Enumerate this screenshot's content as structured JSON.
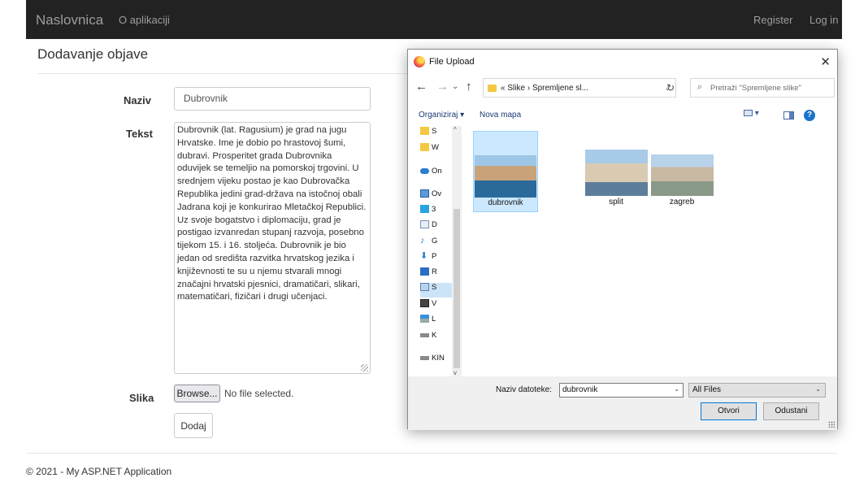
{
  "navbar": {
    "brand": "Naslovnica",
    "about": "O aplikaciji",
    "register": "Register",
    "login": "Log in"
  },
  "page": {
    "heading": "Dodavanje objave"
  },
  "form": {
    "naziv_label": "Naziv",
    "naziv_value": "Dubrovnik",
    "tekst_label": "Tekst",
    "tekst_value": "Dubrovnik (lat. Ragusium) je grad na jugu Hrvatske. Ime je dobio po hrastovoj šumi, dubravi. Prosperitet grada Dubrovnika oduvijek se temeljio na pomorskoj trgovini. U srednjem vijeku postao je kao Dubrovačka Republika jedini grad-država na istočnoj obali Jadrana koji je konkurirao Mletačkoj Republici. Uz svoje bogatstvo i diplomaciju, grad je postigao izvanredan stupanj razvoja, posebno tijekom 15. i 16. stoljeća. Dubrovnik je bio jedan od središta razvitka hrvatskog jezika i književnosti te su u njemu stvarali mnogi značajni hrvatski pjesnici, dramatičari, slikari, matematičari, fizičari i drugi učenjaci.",
    "slika_label": "Slika",
    "browse_label": "Browse...",
    "file_status": "No file selected.",
    "submit_label": "Dodaj"
  },
  "footer": {
    "text": "© 2021 - My ASP.NET Application"
  },
  "dialog": {
    "title": "File Upload",
    "close": "✕",
    "address": {
      "prefix": "«",
      "crumb1": "Slike",
      "sep": "›",
      "crumb2": "Spremljene sl..."
    },
    "search_placeholder": "Pretraži \"Spremljene slike\"",
    "toolbar": {
      "organize": "Organiziraj ▾",
      "new_folder": "Nova mapa",
      "help": "?"
    },
    "nav_items": [
      {
        "label": "S",
        "icon": "folder-icon"
      },
      {
        "label": "W",
        "icon": "folder-icon"
      },
      {
        "label": "On",
        "icon": "cloud-icon"
      },
      {
        "label": "Ov",
        "icon": "computer-icon"
      },
      {
        "label": "3",
        "icon": "objects-3d-icon"
      },
      {
        "label": "D",
        "icon": "documents-icon"
      },
      {
        "label": "G",
        "icon": "music-icon"
      },
      {
        "label": "P",
        "icon": "downloads-icon"
      },
      {
        "label": "R",
        "icon": "desktop-icon"
      },
      {
        "label": "S",
        "icon": "pictures-icon",
        "selected": true
      },
      {
        "label": "V",
        "icon": "videos-icon"
      },
      {
        "label": "L",
        "icon": "network-drive-icon"
      },
      {
        "label": "K",
        "icon": "drive-icon"
      },
      {
        "label": "KIN",
        "icon": "usb-drive-icon"
      }
    ],
    "files": [
      {
        "name": "dubrovnik",
        "selected": true
      },
      {
        "name": "split",
        "selected": false
      },
      {
        "name": "zagreb",
        "selected": false
      }
    ],
    "filename_label": "Naziv datoteke:",
    "filename_value": "dubrovnik",
    "filetype_value": "All Files",
    "open_label": "Otvori",
    "cancel_label": "Odustani"
  },
  "colors": {
    "navbar_bg": "#222222",
    "nav_text": "#9d9d9d",
    "selection": "#cce8ff",
    "accent": "#0078d7"
  }
}
